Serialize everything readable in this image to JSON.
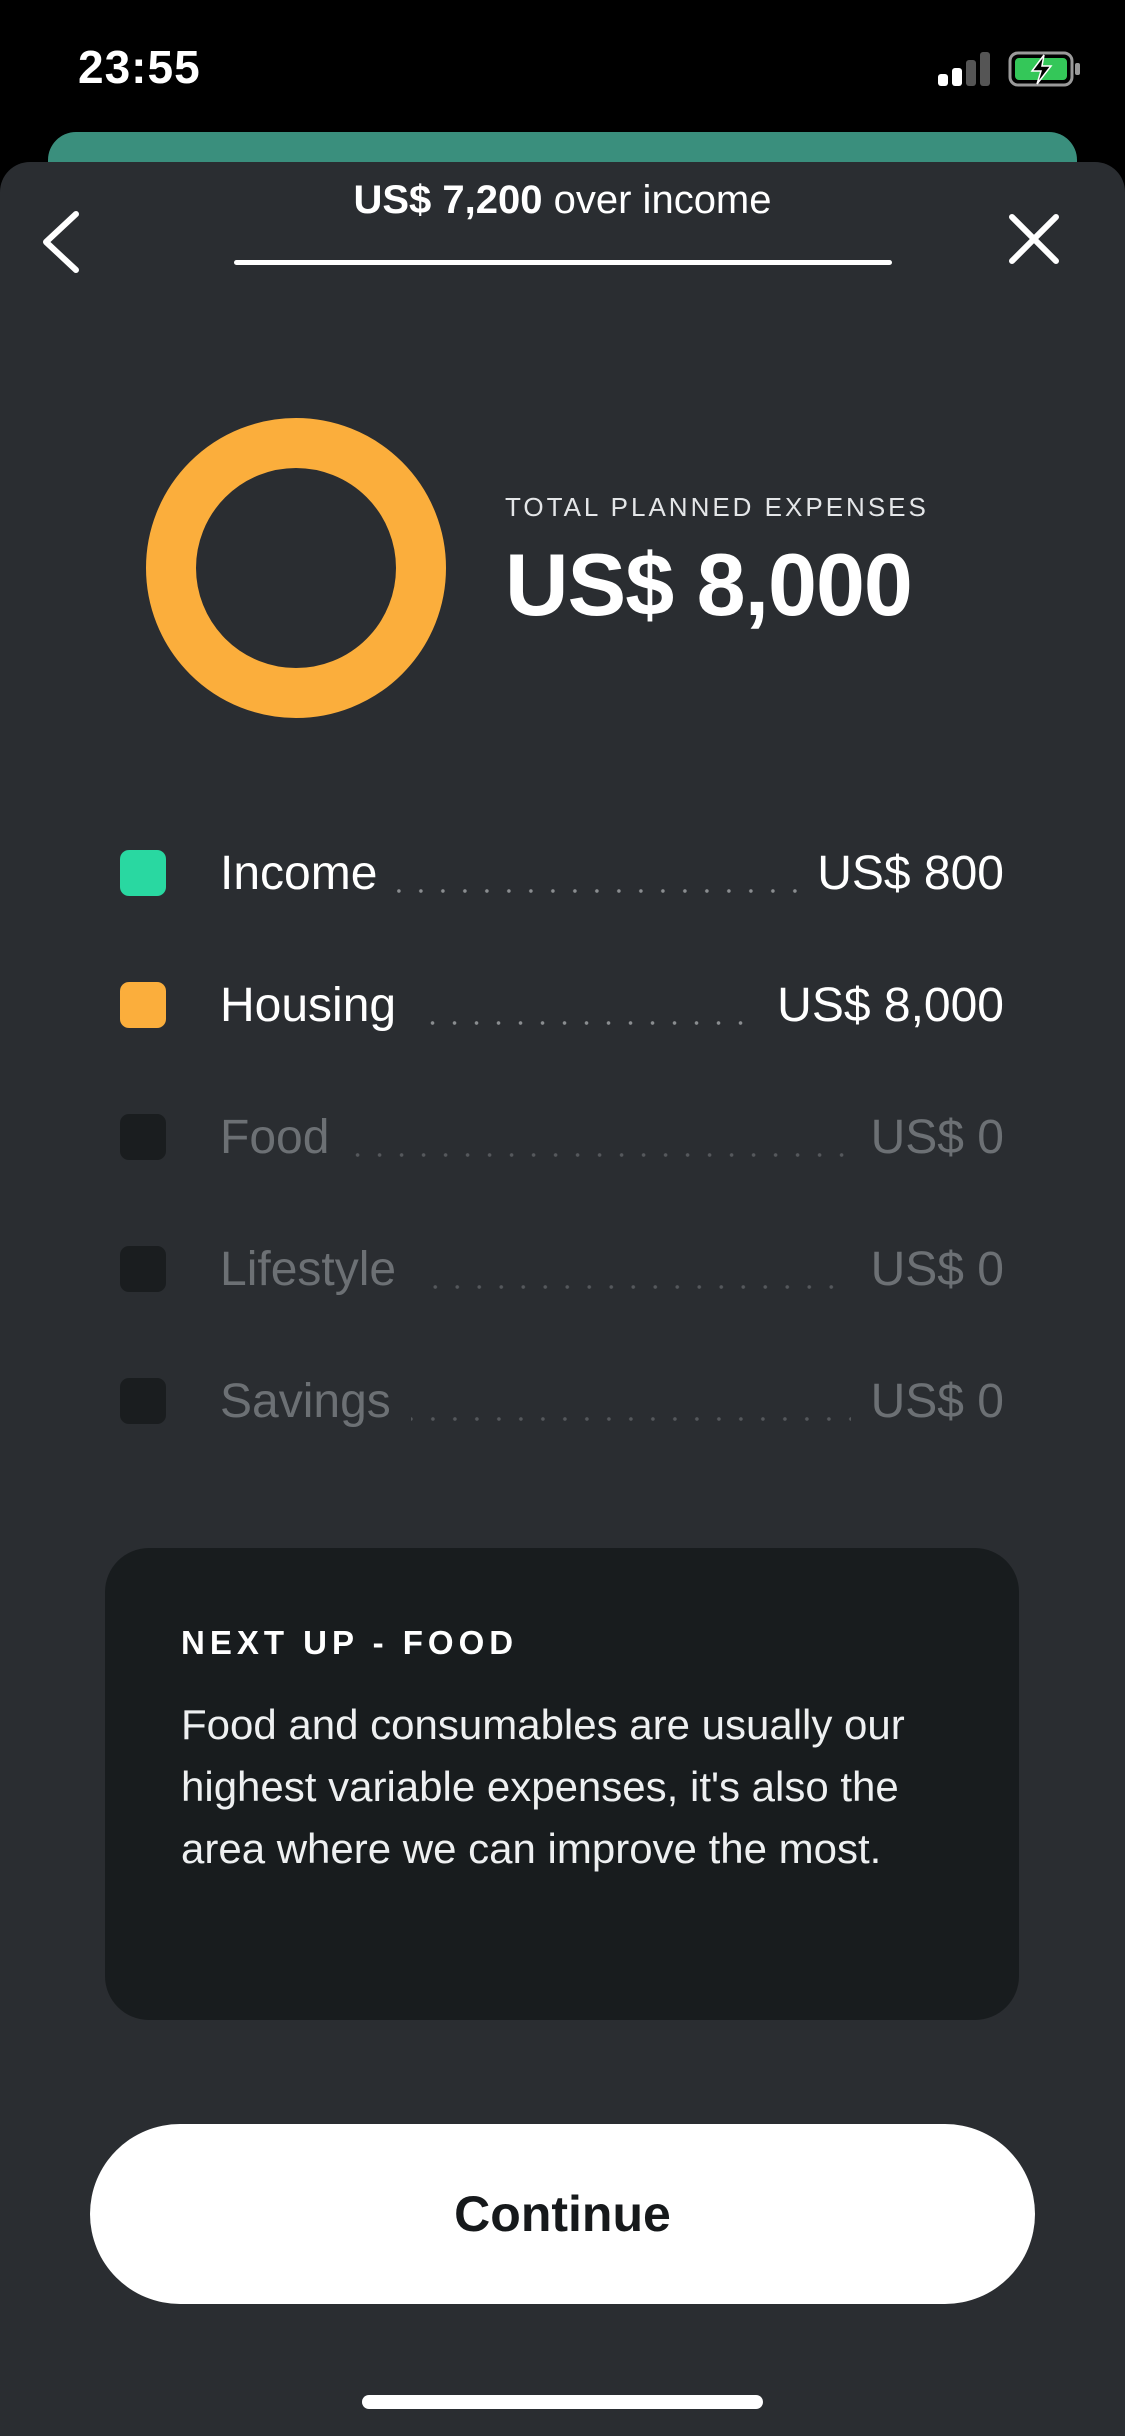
{
  "status_bar": {
    "time": "23:55",
    "signal_icon": "cellular-signal-icon",
    "battery_icon": "battery-charging-icon"
  },
  "header": {
    "over_amount": "US$ 7,200",
    "over_text": " over income",
    "back_icon": "chevron-left-icon",
    "close_icon": "close-icon"
  },
  "summary": {
    "label": "TOTAL PLANNED EXPENSES",
    "value": "US$ 8,000",
    "ring_color": "#fbae3c"
  },
  "legend": [
    {
      "name": "Income",
      "value": "US$ 800",
      "color": "#29d8a1",
      "active": true
    },
    {
      "name": "Housing",
      "value": "US$ 8,000",
      "color": "#fbae3c",
      "active": true
    },
    {
      "name": "Food",
      "value": "US$ 0",
      "color": "#1a1d1f",
      "active": false
    },
    {
      "name": "Lifestyle",
      "value": "US$ 0",
      "color": "#1a1d1f",
      "active": false
    },
    {
      "name": "Savings",
      "value": "US$ 0",
      "color": "#1a1d1f",
      "active": false
    }
  ],
  "info_card": {
    "title": "NEXT UP - FOOD",
    "body": "Food and consumables are usually our highest variable expenses, it's also the area where we can improve the most."
  },
  "continue_button": {
    "label": "Continue"
  }
}
